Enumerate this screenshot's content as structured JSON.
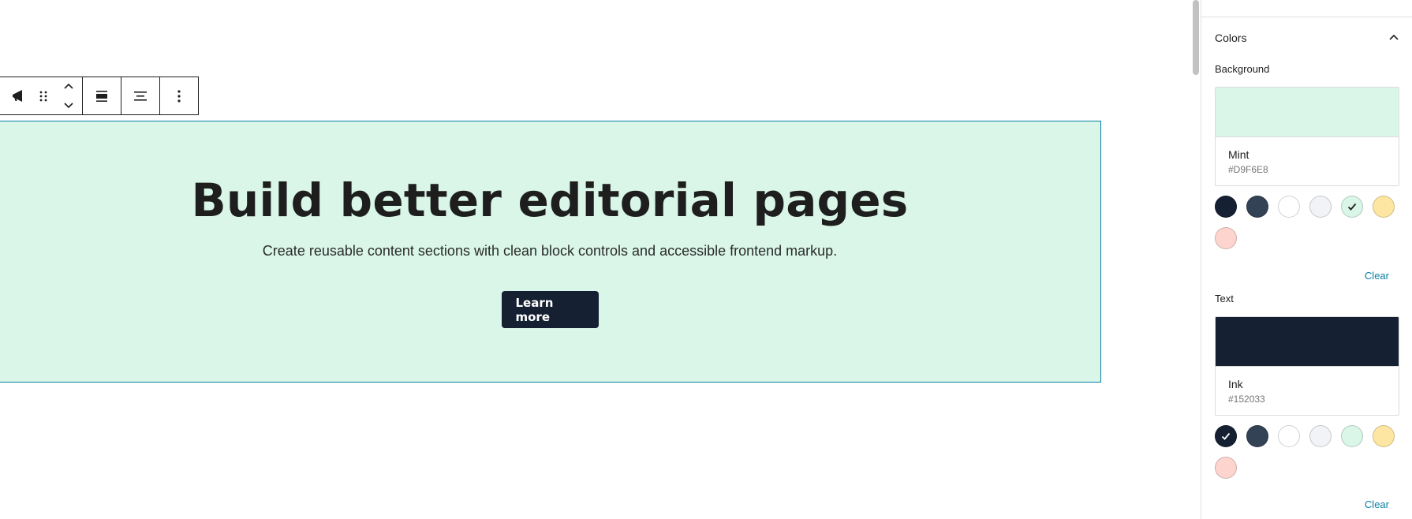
{
  "toolbar": {
    "block_icon": "megaphone-icon",
    "drag_icon": "drag-handle-icon",
    "move_up_icon": "chevron-up-icon",
    "move_down_icon": "chevron-down-icon",
    "align_icon": "align-wide-icon",
    "justify_icon": "justify-center-icon",
    "more_icon": "more-vertical-icon"
  },
  "hero": {
    "title": "Build better editorial pages",
    "subtitle": "Create reusable content sections with clean block controls and accessible frontend markup.",
    "button_label": "Learn more",
    "background_color": "#D9F6E8",
    "border_color": "#0A7FA3",
    "button_color": "#152033"
  },
  "sidebar": {
    "panel_title": "Colors",
    "panel_toggle_icon": "chevron-up-icon",
    "background": {
      "label": "Background",
      "selected_name": "Mint",
      "selected_hex": "#D9F6E8",
      "clear_label": "Clear"
    },
    "text": {
      "label": "Text",
      "selected_name": "Ink",
      "selected_hex": "#152033",
      "clear_label": "Clear"
    },
    "palette": [
      "#152033",
      "#344256",
      "#FFFFFF",
      "#F1F3F7",
      "#D9F6E8",
      "#FDE6A2",
      "#FDD5CE"
    ],
    "accent_color": "#0A7FA3"
  }
}
